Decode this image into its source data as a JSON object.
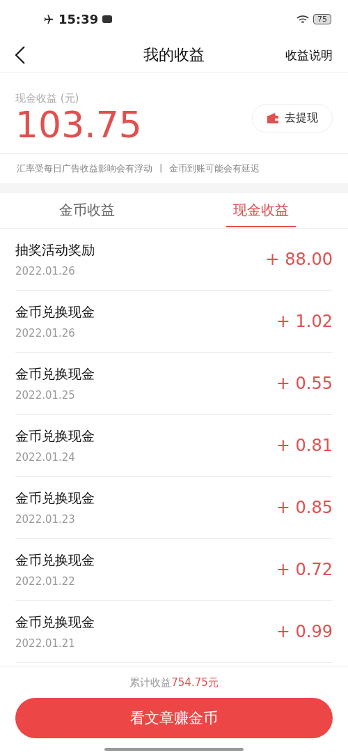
{
  "status_bar": {
    "time": "15:39",
    "battery": "75"
  },
  "nav": {
    "title": "我的收益",
    "action": "收益说明"
  },
  "balance": {
    "label": "现金收益 (元)",
    "amount": "103.75",
    "withdraw": "去提现"
  },
  "notices": [
    "汇率受每日广告收益影响会有浮动",
    "|",
    "金币到账可能会有延迟"
  ],
  "tabs": [
    {
      "label": "金币收益",
      "selected": false
    },
    {
      "label": "现金收益",
      "selected": true
    }
  ],
  "records": [
    {
      "title": "抽奖活动奖励",
      "date": "2022.01.26",
      "amount": "+ 88.00"
    },
    {
      "title": "金币兑换现金",
      "date": "2022.01.26",
      "amount": "+ 1.02"
    },
    {
      "title": "金币兑换现金",
      "date": "2022.01.25",
      "amount": "+ 0.55"
    },
    {
      "title": "金币兑换现金",
      "date": "2022.01.24",
      "amount": "+ 0.81"
    },
    {
      "title": "金币兑换现金",
      "date": "2022.01.23",
      "amount": "+ 0.85"
    },
    {
      "title": "金币兑换现金",
      "date": "2022.01.22",
      "amount": "+ 0.72"
    },
    {
      "title": "金币兑换现金",
      "date": "2022.01.21",
      "amount": "+ 0.99"
    }
  ],
  "total": {
    "label": "累计收益",
    "amount": "754.75元"
  },
  "cta": "看文章赚金币"
}
